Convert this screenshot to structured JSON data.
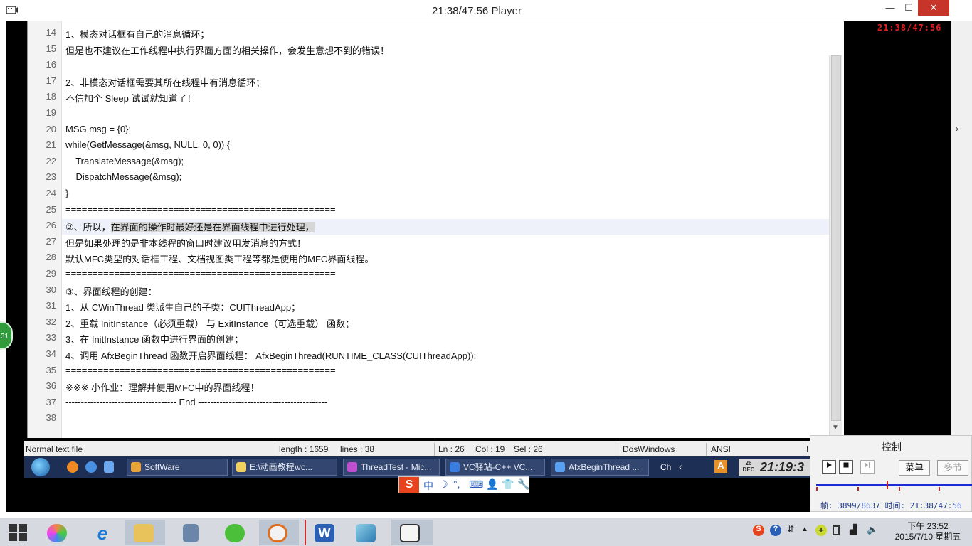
{
  "player": {
    "title": "21:38/47:56 Player",
    "icon": "player-app-icon",
    "controls": {
      "minimize": "—",
      "maximize": "☐",
      "close": "✕"
    }
  },
  "recording": {
    "overlay_clock": "21:38/47:56",
    "editor": {
      "lines": [
        {
          "n": "14",
          "text": "1、模态对话框有自己的消息循环；"
        },
        {
          "n": "15",
          "text": "但是也不建议在工作线程中执行界面方面的相关操作，会发生意想不到的错误！"
        },
        {
          "n": "16",
          "text": ""
        },
        {
          "n": "17",
          "text": "2、非模态对话框需要其所在线程中有消息循环；"
        },
        {
          "n": "18",
          "text": "不信加个 Sleep 试试就知道了！"
        },
        {
          "n": "19",
          "text": ""
        },
        {
          "n": "20",
          "text": "MSG msg = {0};"
        },
        {
          "n": "21",
          "text": "while(GetMessage(&msg, NULL, 0, 0)) {"
        },
        {
          "n": "22",
          "text": "    TranslateMessage(&msg);"
        },
        {
          "n": "23",
          "text": "    DispatchMessage(&msg);"
        },
        {
          "n": "24",
          "text": "}"
        },
        {
          "n": "25",
          "text": "=================================================="
        },
        {
          "n": "26",
          "pre": "②、所以，",
          "sel": "在界面的操作时最好还是在界面线程中进行处理，",
          "post": ""
        },
        {
          "n": "27",
          "text": "但是如果处理的是非本线程的窗口时建议用发消息的方式！"
        },
        {
          "n": "28",
          "text": "默认MFC类型的对话框工程、文档视图类工程等都是使用的MFC界面线程。"
        },
        {
          "n": "29",
          "text": "=================================================="
        },
        {
          "n": "30",
          "text": "③、界面线程的创建："
        },
        {
          "n": "31",
          "text": "1、从 CWinThread 类派生自己的子类：CUIThreadApp；"
        },
        {
          "n": "32",
          "text": "2、重载 InitInstance（必须重载） 与 ExitInstance（可选重载） 函数；"
        },
        {
          "n": "33",
          "text": "3、在 InitInstance 函数中进行界面的创建；"
        },
        {
          "n": "34",
          "text": "4、调用 AfxBeginThread 函数开启界面线程： AfxBeginThread(RUNTIME_CLASS(CUIThreadApp));"
        },
        {
          "n": "35",
          "text": "=================================================="
        },
        {
          "n": "36",
          "text": "※※※ 小作业：理解并使用MFC中的界面线程！"
        },
        {
          "n": "37",
          "text": "------------------------------------ End ------------------------------------------"
        },
        {
          "n": "38",
          "text": ""
        }
      ]
    },
    "statusbar": {
      "file_type": "Normal text file",
      "length": "length : 1659",
      "lines": "lines : 38",
      "ln": "Ln : 26",
      "col": "Col : 19",
      "sel": "Sel : 26",
      "eol": "Dos\\Windows",
      "encoding": "ANSI",
      "mode": "I"
    },
    "taskbar": {
      "items": [
        {
          "label": "SoftWare",
          "color": "#e8a33a"
        },
        {
          "label": "E:\\动画教程\\vc...",
          "color": "#f0d060"
        },
        {
          "label": "ThreadTest - Mic...",
          "color": "#c04fd0"
        },
        {
          "label": "VC驿站-C++ VC...",
          "color": "#3a7de0"
        },
        {
          "label": "AfxBeginThread ...",
          "color": "#5aa0f0"
        }
      ],
      "tray_text": "Ch",
      "clock_time": "21:19:3",
      "clock_day": "26",
      "clock_month": "DEC"
    },
    "ime": {
      "logo": "S",
      "lang": "中",
      "glyphs": [
        "☽",
        "°,",
        "⌨",
        "👤",
        "👕",
        "🔧"
      ]
    }
  },
  "side_indicator": "31",
  "control_panel": {
    "title": "控制",
    "play_icon": "play-icon",
    "stop_icon": "stop-icon",
    "next_icon": "step-icon",
    "menu_label": "菜单",
    "multi_label": "多节",
    "progress": 0.4514,
    "frame_label": "帧: 3899/8637",
    "time_label": "时间: 21:38/47:56"
  },
  "host_taskbar": {
    "time": "下午 23:52",
    "date": "2015/7/10 星期五",
    "tray_icons": [
      "sogou-icon",
      "help-icon",
      "network-arrow-icon",
      "show-hidden-icon",
      "plus-icon",
      "battery-icon",
      "signal-icon",
      "volume-icon"
    ]
  }
}
